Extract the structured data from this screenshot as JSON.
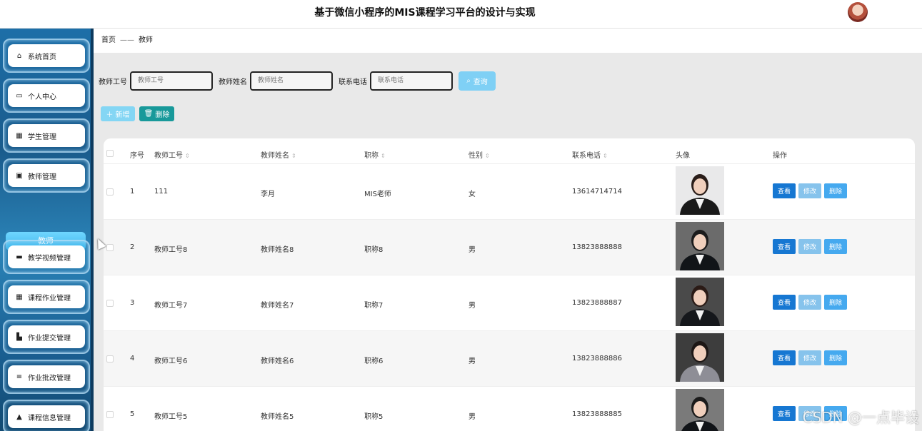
{
  "header": {
    "title": "基于微信小程序的MIS课程学习平台的设计与实现"
  },
  "sidebar": {
    "items": [
      {
        "label": "系统首页",
        "icon": "home-icon",
        "glyph": "⌂"
      },
      {
        "label": "个人中心",
        "icon": "id-card-icon",
        "glyph": "▭"
      },
      {
        "label": "学生管理",
        "icon": "grid-icon",
        "glyph": "▦"
      },
      {
        "label": "教师管理",
        "icon": "chart-icon",
        "glyph": "▣"
      },
      {
        "label": "教学视频管理",
        "icon": "monitor-icon",
        "glyph": "▬"
      },
      {
        "label": "课程作业管理",
        "icon": "grid-icon",
        "glyph": "▦"
      },
      {
        "label": "作业提交管理",
        "icon": "thumb-icon",
        "glyph": "▙"
      },
      {
        "label": "作业批改管理",
        "icon": "list-icon",
        "glyph": "≡"
      },
      {
        "label": "课程信息管理",
        "icon": "user-icon",
        "glyph": "▲"
      }
    ],
    "active_sub": "教师"
  },
  "breadcrumb": {
    "home": "首页",
    "separator": "——",
    "current": "教师"
  },
  "search": {
    "fields": [
      {
        "label": "教师工号",
        "placeholder": "教师工号"
      },
      {
        "label": "教师姓名",
        "placeholder": "教师姓名"
      },
      {
        "label": "联系电话",
        "placeholder": "联系电话"
      }
    ],
    "button": "查询"
  },
  "actions": {
    "add": "新增",
    "delete": "删除"
  },
  "table": {
    "headers": [
      "序号",
      "教师工号",
      "教师姓名",
      "职称",
      "性别",
      "联系电话",
      "头像",
      "操作"
    ],
    "rows": [
      {
        "index": "1",
        "id": "111",
        "name": "李月",
        "title": "MIS老师",
        "gender": "女",
        "phone": "13614714714"
      },
      {
        "index": "2",
        "id": "教师工号8",
        "name": "教师姓名8",
        "title": "职称8",
        "gender": "男",
        "phone": "13823888888"
      },
      {
        "index": "3",
        "id": "教师工号7",
        "name": "教师姓名7",
        "title": "职称7",
        "gender": "男",
        "phone": "13823888887"
      },
      {
        "index": "4",
        "id": "教师工号6",
        "name": "教师姓名6",
        "title": "职称6",
        "gender": "男",
        "phone": "13823888886"
      },
      {
        "index": "5",
        "id": "教师工号5",
        "name": "教师姓名5",
        "title": "职称5",
        "gender": "男",
        "phone": "13823888885"
      }
    ],
    "op_labels": {
      "view": "查看",
      "edit": "修改",
      "remove": "删除"
    }
  },
  "watermark": "CSDN @一点毕设"
}
